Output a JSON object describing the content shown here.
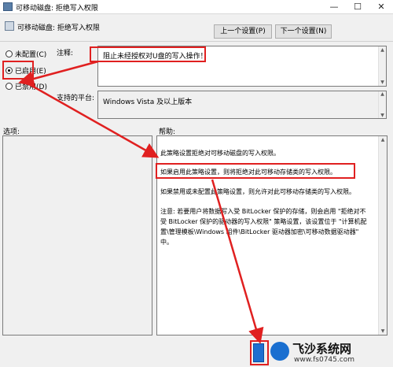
{
  "window": {
    "title": "可移动磁盘: 拒绝写入权限",
    "minimize": "—",
    "maximize": "☐",
    "close": "✕"
  },
  "header": {
    "policy_name": "可移动磁盘: 拒绝写入权限",
    "prev_label": "上一个设置(P)",
    "next_label": "下一个设置(N)"
  },
  "options": [
    {
      "label": "未配置(C)",
      "selected": false
    },
    {
      "label": "已启用(E)",
      "selected": true
    },
    {
      "label": "已禁用(D)",
      "selected": false
    }
  ],
  "comment": {
    "label": "注释:",
    "value": "阻止未经授权对U盘的写入操作！"
  },
  "supported": {
    "label": "支持的平台:",
    "value": "Windows Vista 及以上版本"
  },
  "options_label": "选项:",
  "help": {
    "label": "帮助:",
    "p1": "此策略设置拒绝对可移动磁盘的写入权限。",
    "p2": "如果启用此策略设置，则将拒绝对此可移动存储类的写入权限。",
    "p3": "如果禁用或未配置此策略设置，则允许对此可移动存储类的写入权限。",
    "p4": "注意: 若要用户将数据写入受 BitLocker 保护的存储，则会启用 \"拒绝对不受 BitLocker 保护的驱动器的写入权限\" 策略设置，该设置位于 \"计算机配置\\管理模板\\Windows 组件\\BitLocker 驱动器加密\\可移动数据驱动器\" 中。"
  },
  "watermark": {
    "name": "飞沙系统网",
    "url": "www.fs0745.com"
  },
  "colors": {
    "annotation": "#e02020",
    "window_bg": "#f0f0f0",
    "button_bg": "#e1e1e1"
  }
}
